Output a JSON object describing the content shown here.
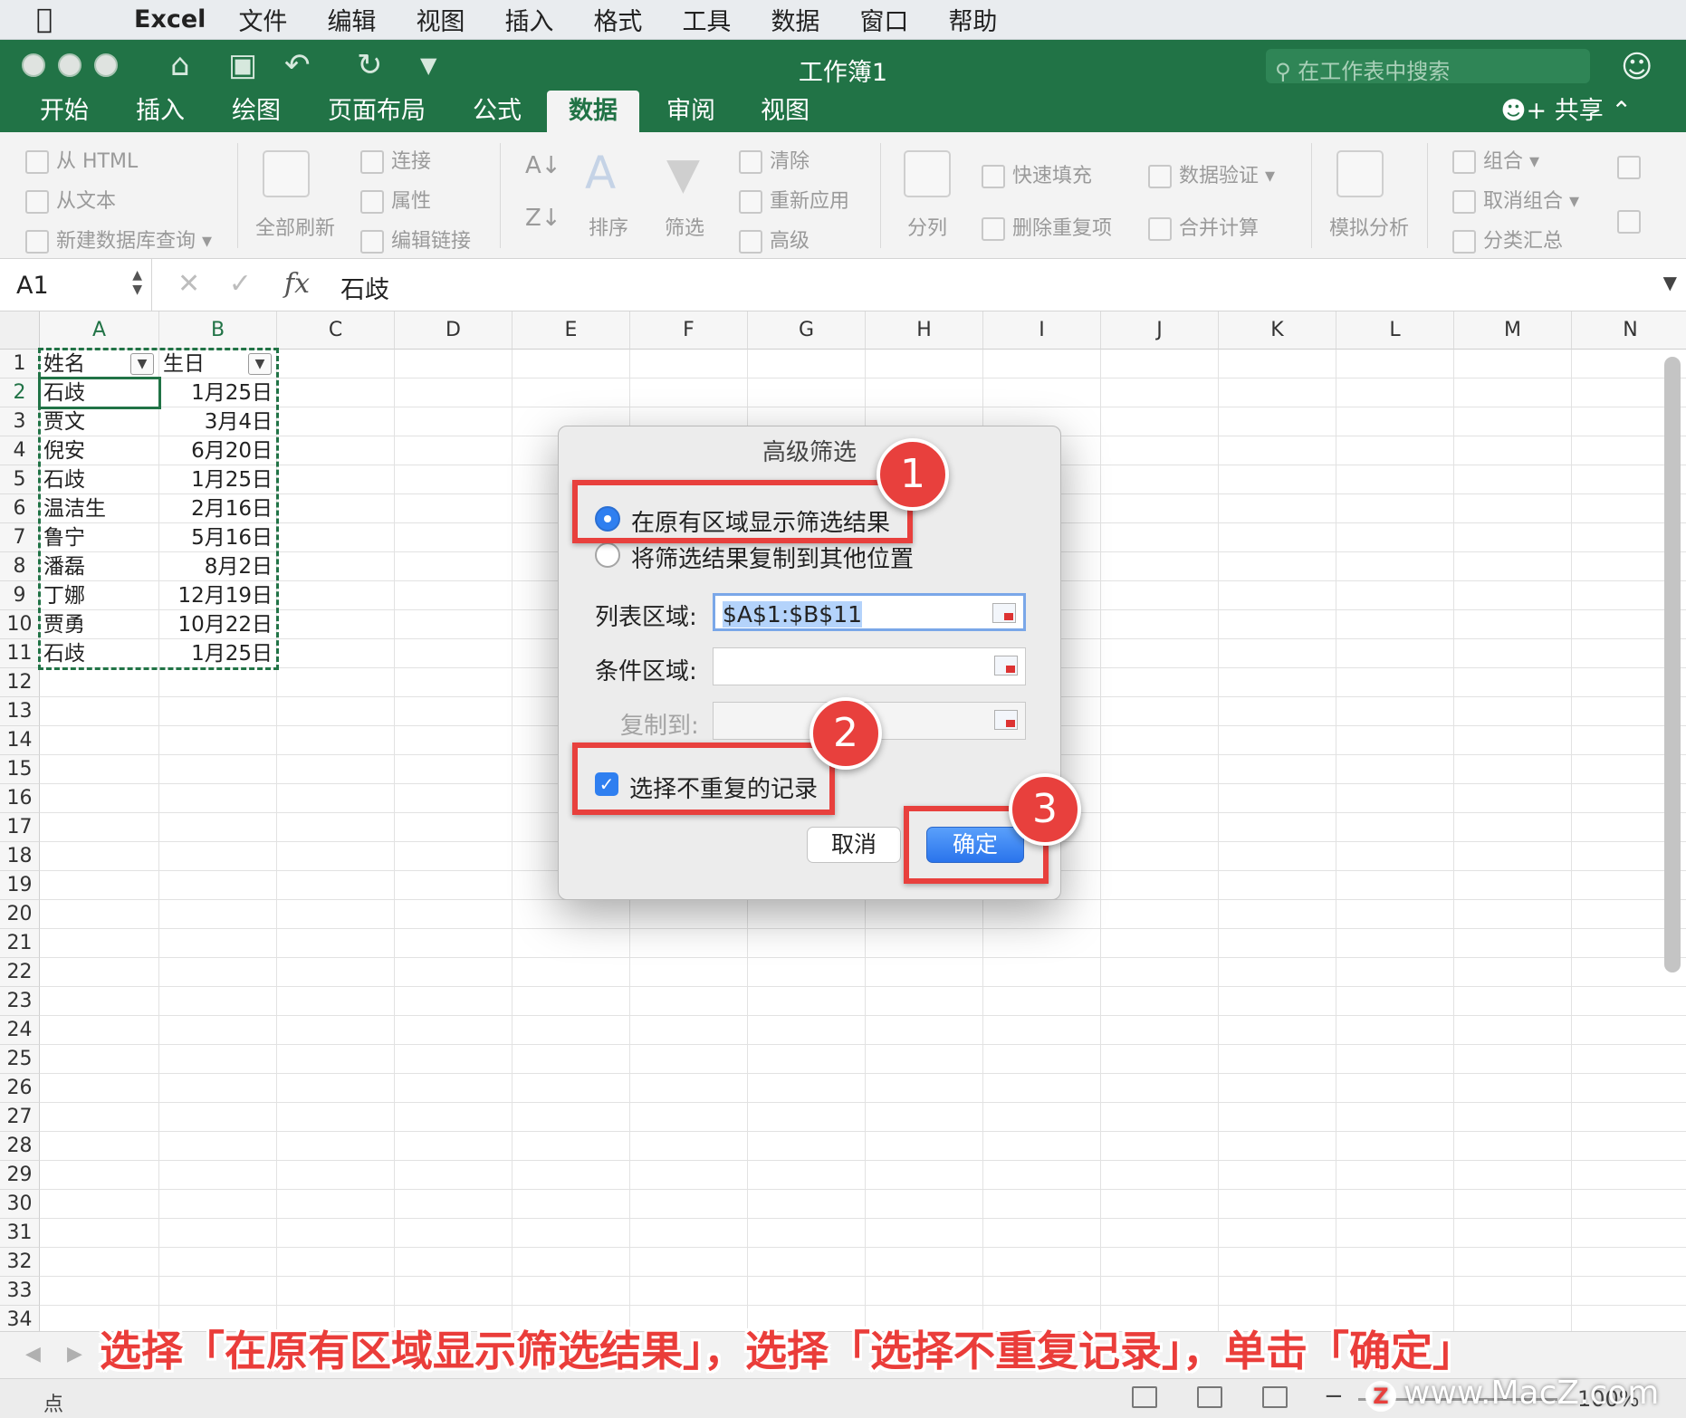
{
  "menubar": {
    "app_name": "Excel",
    "items": [
      "文件",
      "编辑",
      "视图",
      "插入",
      "格式",
      "工具",
      "数据",
      "窗口",
      "帮助"
    ]
  },
  "window": {
    "title": "工作簿1",
    "search_placeholder": "在工作表中搜索",
    "share_label": "共享"
  },
  "tabs": [
    "开始",
    "插入",
    "绘图",
    "页面布局",
    "公式",
    "数据",
    "审阅",
    "视图"
  ],
  "active_tab": "数据",
  "ribbon": {
    "from_html": "从 HTML",
    "from_text": "从文本",
    "new_db_query": "新建数据库查询",
    "refresh_all": "全部刷新",
    "connections": "连接",
    "properties": "属性",
    "edit_links": "编辑链接",
    "sort": "排序",
    "filter": "筛选",
    "clear": "清除",
    "reapply": "重新应用",
    "advanced": "高级",
    "text_to_columns": "分列",
    "flash_fill": "快速填充",
    "remove_duplicates": "删除重复项",
    "data_validation": "数据验证",
    "consolidate": "合并计算",
    "what_if": "模拟分析",
    "group": "组合",
    "ungroup": "取消组合",
    "subtotal": "分类汇总"
  },
  "formula_bar": {
    "name_box": "A1",
    "fx_label": "fx",
    "value": "石歧"
  },
  "sheet": {
    "columns": [
      "A",
      "B",
      "C",
      "D",
      "E",
      "F",
      "G",
      "H",
      "I",
      "J",
      "K",
      "L",
      "M",
      "N"
    ],
    "rows": [
      "1",
      "2",
      "3",
      "4",
      "5",
      "6",
      "7",
      "8",
      "9",
      "10",
      "11",
      "12",
      "13",
      "14",
      "15",
      "16",
      "17",
      "18",
      "19",
      "20",
      "21",
      "22",
      "23",
      "24",
      "25",
      "26",
      "27",
      "28",
      "29",
      "30",
      "31",
      "32",
      "33",
      "34"
    ],
    "headers": [
      "姓名",
      "生日"
    ],
    "data": [
      [
        "石歧",
        "1月25日"
      ],
      [
        "贾文",
        "3月4日"
      ],
      [
        "倪安",
        "6月20日"
      ],
      [
        "石歧",
        "1月25日"
      ],
      [
        "温洁生",
        "2月16日"
      ],
      [
        "鲁宁",
        "5月16日"
      ],
      [
        "潘磊",
        "8月2日"
      ],
      [
        "丁娜",
        "12月19日"
      ],
      [
        "贾勇",
        "10月22日"
      ],
      [
        "石歧",
        "1月25日"
      ]
    ],
    "active_row": "2"
  },
  "dialog": {
    "title": "高级筛选",
    "option_in_place": "在原有区域显示筛选结果",
    "option_copy": "将筛选结果复制到其他位置",
    "list_range_label": "列表区域:",
    "list_range_value": "$A$1:$B$11",
    "criteria_label": "条件区域:",
    "criteria_value": "",
    "copy_to_label": "复制到:",
    "copy_to_value": "",
    "unique_label": "选择不重复的记录",
    "unique_checked": true,
    "cancel_label": "取消",
    "ok_label": "确定"
  },
  "annotations": {
    "badges": [
      "1",
      "2",
      "3"
    ],
    "caption": "选择「在原有区域显示筛选结果」，选择「选择不重复记录」，单击「确定」",
    "color": "#e8403d"
  },
  "statusbar": {
    "mode": "点",
    "zoom": "100%",
    "watermark": "www.MacZ.com",
    "watermark_logo": "Z"
  },
  "colors": {
    "excel_green": "#217346",
    "accent_blue": "#2f7ff0"
  }
}
